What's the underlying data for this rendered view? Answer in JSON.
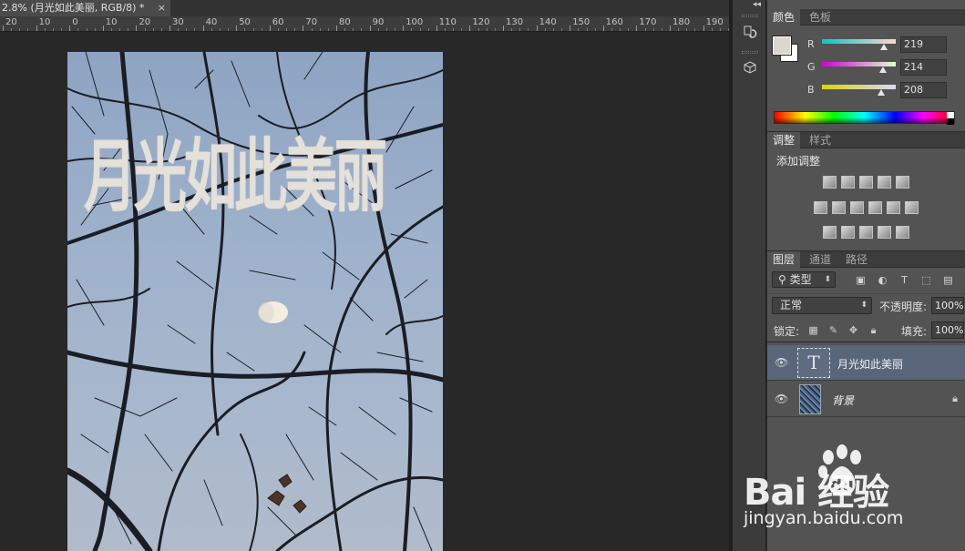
{
  "document": {
    "tab_title": "2.8% (月光如此美丽, RGB/8) *",
    "close_glyph": "×",
    "canvas_text": "月光如此美丽"
  },
  "ruler": {
    "labels": [
      "20",
      "10",
      "0",
      "10",
      "20",
      "30",
      "40",
      "50",
      "60",
      "70",
      "80",
      "90",
      "100",
      "110",
      "120",
      "130",
      "140",
      "150",
      "160",
      "170",
      "180",
      "190"
    ]
  },
  "color_panel": {
    "tabs": [
      "颜色",
      "色板"
    ],
    "active_tab": 0,
    "foreground": "#dbd6d0",
    "background": "#ffffff",
    "channels": [
      {
        "label": "R",
        "value": "219",
        "gradient": [
          "#00c8c8",
          "#ffd6d0"
        ]
      },
      {
        "label": "G",
        "value": "214",
        "gradient": [
          "#d000d0",
          "#dbffd0"
        ]
      },
      {
        "label": "B",
        "value": "208",
        "gradient": [
          "#dbd600",
          "#dbd6ff"
        ]
      }
    ]
  },
  "adjustments_panel": {
    "tabs": [
      "调整",
      "样式"
    ],
    "active_tab": 0,
    "title": "添加调整"
  },
  "layers_panel": {
    "tabs": [
      "图层",
      "通道",
      "路径"
    ],
    "active_tab": 0,
    "kind_filter": "类型",
    "blend_mode": "正常",
    "opacity_label": "不透明度:",
    "opacity_value": "100%",
    "lock_label": "锁定:",
    "fill_label": "填充:",
    "fill_value": "100%",
    "layers": [
      {
        "name": "月光如此美丽",
        "type": "text",
        "selected": true,
        "thumb_glyph": "T"
      },
      {
        "name": "背景",
        "type": "image",
        "selected": false,
        "locked": true
      }
    ]
  },
  "watermark": {
    "brand": "Bai  经验",
    "sub": "jingyan.baidu.com"
  }
}
